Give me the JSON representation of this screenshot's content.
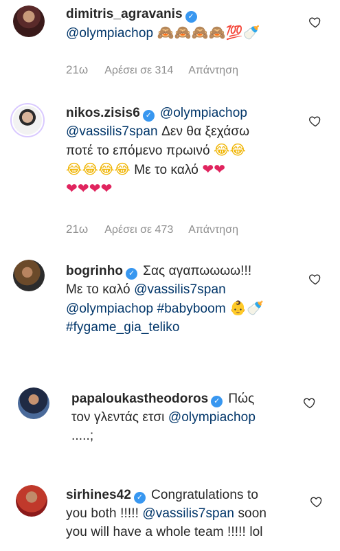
{
  "comments": [
    {
      "username": "dimitris_agravanis",
      "mention1": "@olympiachop",
      "emoji": "🙈🙈🙈🙈💯🍼",
      "time": "21ω",
      "likes": "Αρέσει σε 314",
      "reply": "Απάντηση"
    },
    {
      "username": "nikos.zisis6",
      "mention1": "@olympiachop",
      "mention2": "@vassilis7span",
      "text1": "Δεν θα ξεχάσω",
      "text2": "ποτέ το επόμενο πρωινό",
      "emoji1": "😂😂",
      "emoji2": "😂😂😂😂",
      "text3": "Με το καλό",
      "emoji3": "❤❤",
      "emoji4": "❤❤❤❤",
      "time": "21ω",
      "likes": "Αρέσει σε 473",
      "reply": "Απάντηση"
    },
    {
      "username": "bogrinho",
      "text1": "Σας αγαπωωωω!!!",
      "text2": "Με το καλό",
      "mention1": "@vassilis7span",
      "mention2": "@olympiachop",
      "hashtag1": "#babyboom",
      "emoji1": "👶🍼",
      "hashtag2": "#fygame_gia_teliko"
    },
    {
      "username": "papaloukastheodoros",
      "text1": "Πώς",
      "text2": "τον γλεντάς ετσι",
      "mention1": "@olympiachop",
      "text3": ".....;"
    },
    {
      "username": "sirhines42",
      "text1": "Congratulations to",
      "text2": "you both !!!!!",
      "mention1": "@vassilis7span",
      "text3": "soon",
      "text4": "you will have a whole team !!!!! lol"
    }
  ],
  "icons": {
    "verified": "verified-badge-icon",
    "like": "heart-outline-icon"
  },
  "colors": {
    "link": "#003569",
    "verified": "#3897f0",
    "meta": "#8e8e8e"
  }
}
